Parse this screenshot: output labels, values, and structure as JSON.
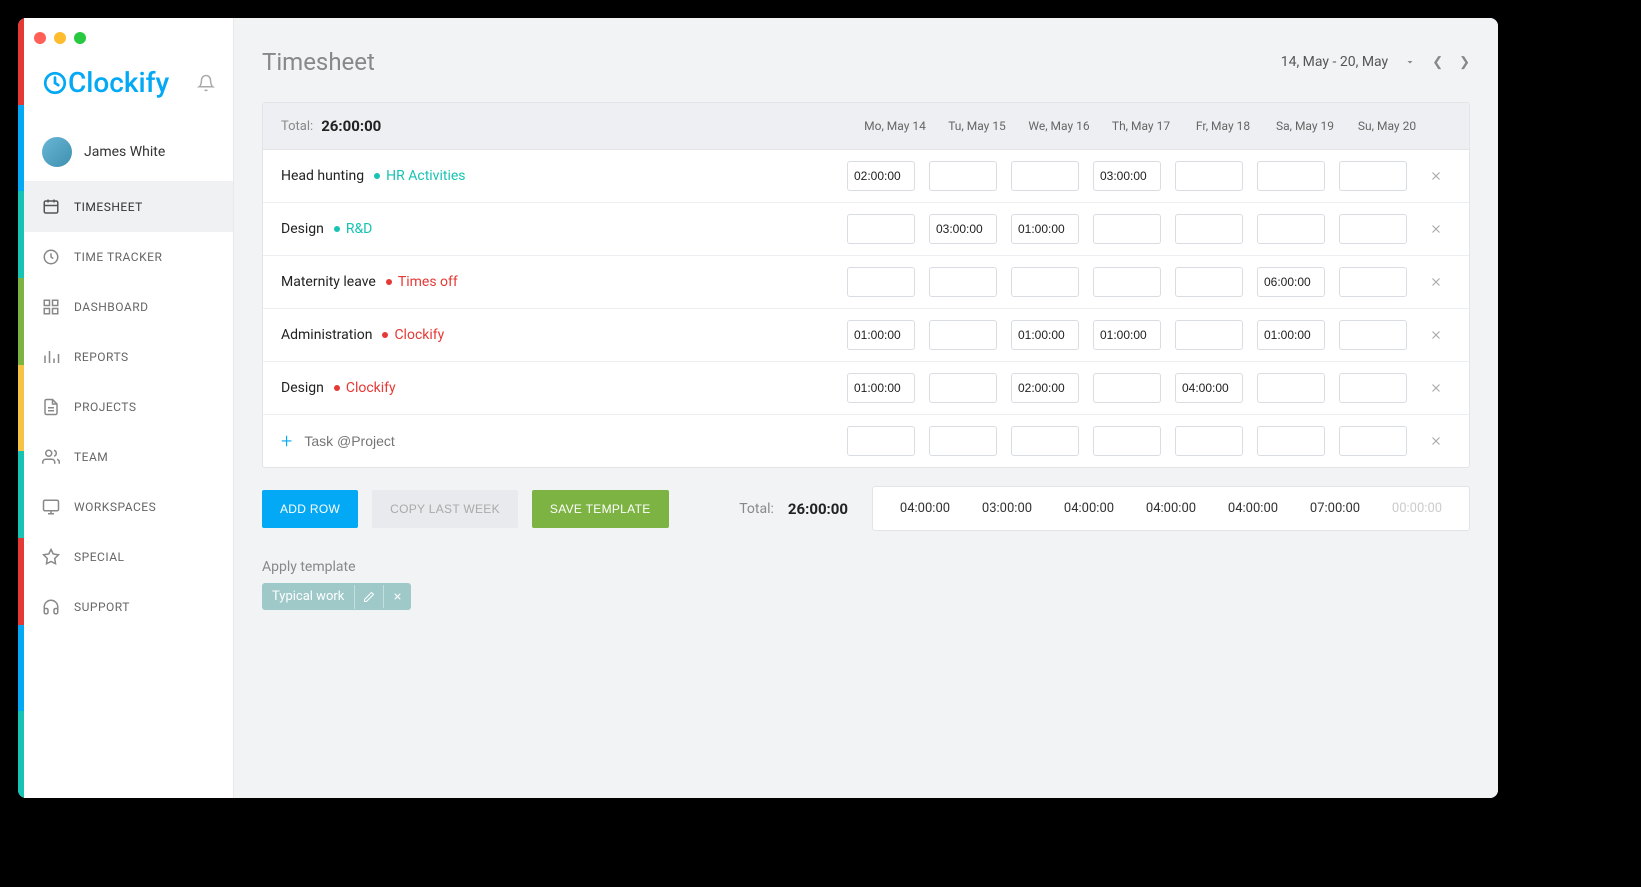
{
  "app": {
    "brand": "Clockify"
  },
  "user": {
    "name": "James White"
  },
  "sidebar": {
    "items": [
      {
        "label": "TIMESHEET"
      },
      {
        "label": "TIME TRACKER"
      },
      {
        "label": "DASHBOARD"
      },
      {
        "label": "REPORTS"
      },
      {
        "label": "PROJECTS"
      },
      {
        "label": "TEAM"
      },
      {
        "label": "WORKSPACES"
      },
      {
        "label": "SPECIAL"
      },
      {
        "label": "SUPPORT"
      }
    ]
  },
  "page": {
    "title": "Timesheet",
    "range": "14, May - 20, May",
    "totalLabel": "Total:",
    "totalValue": "26:00:00"
  },
  "days": [
    "Mo, May 14",
    "Tu, May 15",
    "We, May 16",
    "Th, May 17",
    "Fr, May 18",
    "Sa, May 19",
    "Su, May 20"
  ],
  "rows": [
    {
      "task": "Head hunting",
      "project": "HR Activities",
      "color": "#17c3b2",
      "cells": [
        "02:00:00",
        "",
        "",
        "03:00:00",
        "",
        "",
        ""
      ]
    },
    {
      "task": "Design",
      "project": "R&D",
      "color": "#17c3b2",
      "cells": [
        "",
        "03:00:00",
        "01:00:00",
        "",
        "",
        "",
        ""
      ]
    },
    {
      "task": "Maternity leave",
      "project": "Times off",
      "color": "#e53935",
      "cells": [
        "",
        "",
        "",
        "",
        "",
        "06:00:00",
        ""
      ]
    },
    {
      "task": "Administration",
      "project": "Clockify",
      "color": "#e53935",
      "cells": [
        "01:00:00",
        "",
        "01:00:00",
        "01:00:00",
        "",
        "01:00:00",
        ""
      ]
    },
    {
      "task": "Design",
      "project": "Clockify",
      "color": "#e53935",
      "cells": [
        "01:00:00",
        "",
        "02:00:00",
        "",
        "04:00:00",
        "",
        ""
      ]
    }
  ],
  "newRow": {
    "placeholder": "Task @Project"
  },
  "buttons": {
    "add": "ADD ROW",
    "copy": "COPY LAST WEEK",
    "save": "SAVE TEMPLATE"
  },
  "footerTotals": {
    "label": "Total:",
    "value": "26:00:00",
    "cells": [
      "04:00:00",
      "03:00:00",
      "04:00:00",
      "04:00:00",
      "04:00:00",
      "07:00:00",
      "00:00:00"
    ]
  },
  "template": {
    "label": "Apply template",
    "chip": "Typical work"
  },
  "stripeColors": [
    "#e53935",
    "#03a9f4",
    "#17c3b2",
    "#7cb342",
    "#f6c445",
    "#17c3b2",
    "#e53935",
    "#03a9f4",
    "#17c3b2"
  ]
}
